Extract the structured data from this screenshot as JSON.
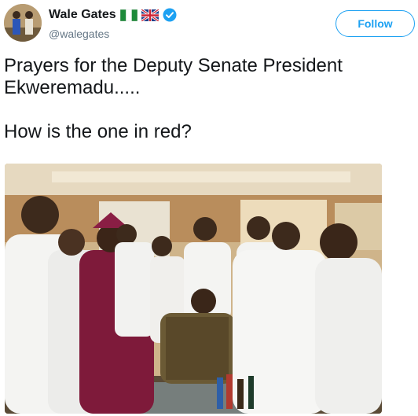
{
  "user": {
    "display_name": "Wale Gates",
    "handle": "@walegates",
    "flags": [
      "nigeria-flag",
      "uk-flag"
    ],
    "verified_icon": "verified-badge-icon"
  },
  "follow_label": "Follow",
  "tweet": {
    "line1": "Prayers for the Deputy Senate President",
    "line2": "Ekweremadu.....",
    "line3": "",
    "line4": "How is the one in red?"
  },
  "colors": {
    "accent": "#1da1f2",
    "text": "#14171a",
    "muted": "#657786"
  }
}
